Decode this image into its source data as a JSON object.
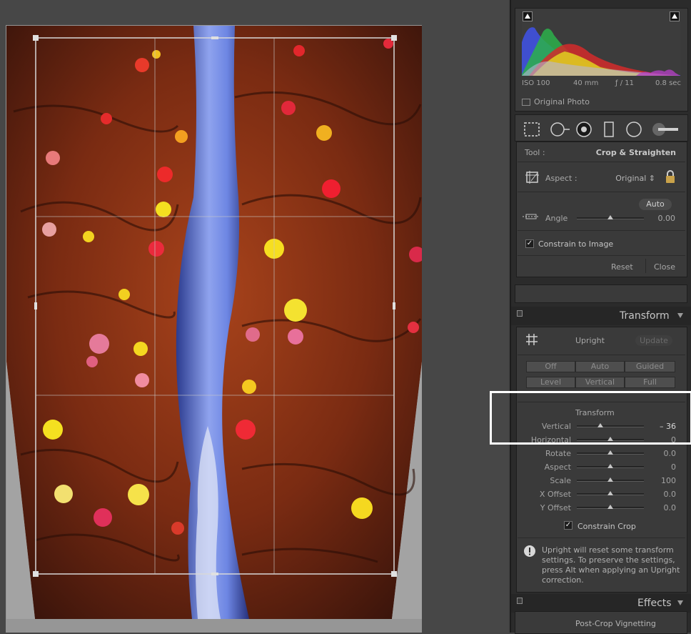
{
  "histogram": {
    "exif": {
      "iso": "ISO 100",
      "focal": "40 mm",
      "aperture": "ƒ / 11",
      "shutter": "0.8 sec"
    },
    "original_photo_label": "Original Photo"
  },
  "crop_panel": {
    "tool_label": "Tool :",
    "tool_value": "Crop & Straighten",
    "aspect_label": "Aspect :",
    "aspect_value": "Original ⇕",
    "auto_button": "Auto",
    "angle_label": "Angle",
    "angle_value": "0.00",
    "constrain_to_image": "Constrain to Image",
    "constrain_checked": true,
    "reset_button": "Reset",
    "close_button": "Close"
  },
  "transform_panel": {
    "header": "Transform",
    "upright_label": "Upright",
    "update_button": "Update",
    "upright_buttons_row1": [
      "Off",
      "Auto",
      "Guided"
    ],
    "upright_buttons_row2": [
      "Level",
      "Vertical",
      "Full"
    ],
    "section_title": "Transform",
    "sliders": [
      {
        "label": "Vertical",
        "value": "– 36",
        "position": 0.35
      },
      {
        "label": "Horizontal",
        "value": "0",
        "position": 0.5
      },
      {
        "label": "Rotate",
        "value": "0.0",
        "position": 0.5
      },
      {
        "label": "Aspect",
        "value": "0",
        "position": 0.5
      },
      {
        "label": "Scale",
        "value": "100",
        "position": 0.5
      },
      {
        "label": "X Offset",
        "value": "0.0",
        "position": 0.5
      },
      {
        "label": "Y Offset",
        "value": "0.0",
        "position": 0.5
      }
    ],
    "constrain_crop": "Constrain Crop",
    "constrain_checked": true,
    "info_text": "Upright will reset some transform settings. To preserve the settings, press Alt when applying an Upright correction."
  },
  "effects_panel": {
    "header": "Effects",
    "post_crop": "Post-Crop Vignetting"
  },
  "colors": {
    "panel_bg": "#3a3a3a",
    "highlight": "#ffffff"
  }
}
